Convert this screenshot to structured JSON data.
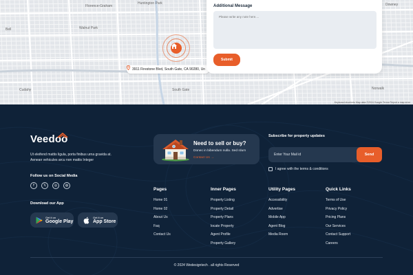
{
  "map": {
    "labels": [
      "Florence-Graham",
      "Huntington Park",
      "Bell",
      "Cudahy",
      "Walnut Park",
      "South Gate",
      "Downey",
      "Norwalk"
    ],
    "address": "3911 Firestone Blvd, South Gate, CA 90280, Un",
    "attribution": "Keyboard shortcuts   Map data ©2024 Google   Terms   Report a map error"
  },
  "form": {
    "label": "Additional Message",
    "placeholder": "Please write any note here....",
    "submit_label": "Submit"
  },
  "footer": {
    "logo": "Veedoo",
    "description": "Ut eleifend mattis ligula, porta finibus urna gravida at. Aenean vehicules arcu non mattis Integer",
    "social_title": "Follow us on Social Media",
    "social_icons": [
      "facebook-icon",
      "x-icon",
      "instagram-icon",
      "dribbble-icon"
    ],
    "social_glyphs": [
      "f",
      "𝕏",
      "◎",
      "◍"
    ],
    "download_title": "Download our App",
    "google_play": {
      "small": "Get it on",
      "big": "Google Play"
    },
    "app_store": {
      "small": "Get it on",
      "big": "App Store"
    },
    "sell": {
      "title": "Need to sell or buy?",
      "desc": "Donec in bibendum nulla. Sed rdum",
      "link": "Contact Us →"
    },
    "subscribe": {
      "title": "Subscribe for property updates",
      "placeholder": "Enter Your Mail id",
      "send_label": "Send",
      "terms": "I agree with the terms & conditions"
    },
    "columns": [
      {
        "title": "Pages",
        "items": [
          "Home 01",
          "Home 02",
          "About Us",
          "Faq",
          "Contact Us"
        ]
      },
      {
        "title": "Inner Pages",
        "items": [
          "Property Listing",
          "Property Detail",
          "Property Plans",
          "locate Property",
          "Agent Profile",
          "Property Gallery"
        ]
      },
      {
        "title": "Utility Pages",
        "items": [
          "Accessibility",
          "Advertise",
          "Mobile App",
          "Agent Blog",
          "Media Room"
        ]
      },
      {
        "title": "Quick Links",
        "items": [
          "Terms of Use",
          "Privacy Policy",
          "Pricing Plans",
          "Our Services",
          "Contact Support",
          "Careers"
        ]
      }
    ],
    "copyright": "© 2024 Wedesigntech . all rights Reserved"
  },
  "colors": {
    "accent": "#e85e2a",
    "footer_bg": "#0f2238",
    "card_bg": "#25384f",
    "map_bg": "#dfe3e8"
  }
}
